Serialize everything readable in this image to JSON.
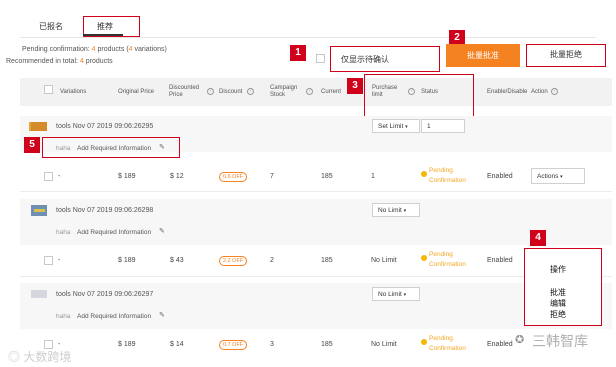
{
  "tabs": [
    {
      "label": "已报名"
    },
    {
      "label": "推荐"
    }
  ],
  "summary": {
    "pending_prefix": "Pending confirmation:",
    "pending_products": "4",
    "pending_products_word": "products (",
    "pending_variations": "4",
    "pending_variations_word": "variations)",
    "recommended_prefix": "Recommended in total:",
    "recommended_products": "4",
    "recommended_products_word": "products"
  },
  "controls": {
    "only_pending_label": "仅显示待确认",
    "batch_approve_label": "批量批准",
    "batch_reject_label": "批量拒绝"
  },
  "callouts": [
    "1",
    "2",
    "3",
    "4",
    "5"
  ],
  "columns": {
    "variations": "Variations",
    "original_price": "Original Price",
    "discounted_price_1": "Discounted",
    "discounted_price_2": "Price",
    "discount": "Discount",
    "campaign_stock_1": "Campaign",
    "campaign_stock_2": "Stock",
    "current": "Current",
    "purchase_limit_1": "Purchase",
    "purchase_limit_2": "limit",
    "status": "Status",
    "enable_disable": "Enable/Disable",
    "action": "Action"
  },
  "help_icon": "?",
  "products": [
    {
      "name": "tools Nov 07 2019 09:06:26295",
      "limit_select": "Set Limit",
      "limit_value": "1",
      "brand": "haha",
      "add_info": "Add Required Information",
      "variation": "-",
      "original_price": "$ 189",
      "discounted_price": "$ 12",
      "discount": "0.6 OFF",
      "stock": "7",
      "current": "185",
      "purchase_limit": "1",
      "status_1": "Pending",
      "status_2": "Confirmation",
      "enabled": "Enabled",
      "action": "Actions"
    },
    {
      "name": "tools Nov 07 2019 09:06:26298",
      "limit_select": "No Limit",
      "brand": "haha",
      "add_info": "Add Required Information",
      "variation": "-",
      "original_price": "$ 189",
      "discounted_price": "$ 43",
      "discount": "2.2 OFF",
      "stock": "2",
      "current": "185",
      "purchase_limit": "No Limit",
      "status_1": "Pending",
      "status_2": "Confirmation",
      "enabled": "Enabled"
    },
    {
      "name": "tools Nov 07 2019 09:06:26297",
      "limit_select": "No Limit",
      "brand": "haha",
      "add_info": "Add Required Information",
      "variation": "-",
      "original_price": "$ 189",
      "discounted_price": "$ 14",
      "discount": "0.7 OFF",
      "stock": "3",
      "current": "185",
      "purchase_limit": "No Limit",
      "status_1": "Pending",
      "status_2": "Confirmation",
      "enabled": "Enabled"
    }
  ],
  "action_menu": {
    "title": "操作",
    "items": [
      "批准",
      "编辑",
      "拒绝"
    ]
  },
  "watermark_left": "大数跨境",
  "watermark_right": "三韩智库",
  "colors": {
    "accent": "#f58220",
    "callout_red": "#d0021b",
    "header_bg": "#f2f2f2",
    "pending_yellow": "#f5b800"
  }
}
